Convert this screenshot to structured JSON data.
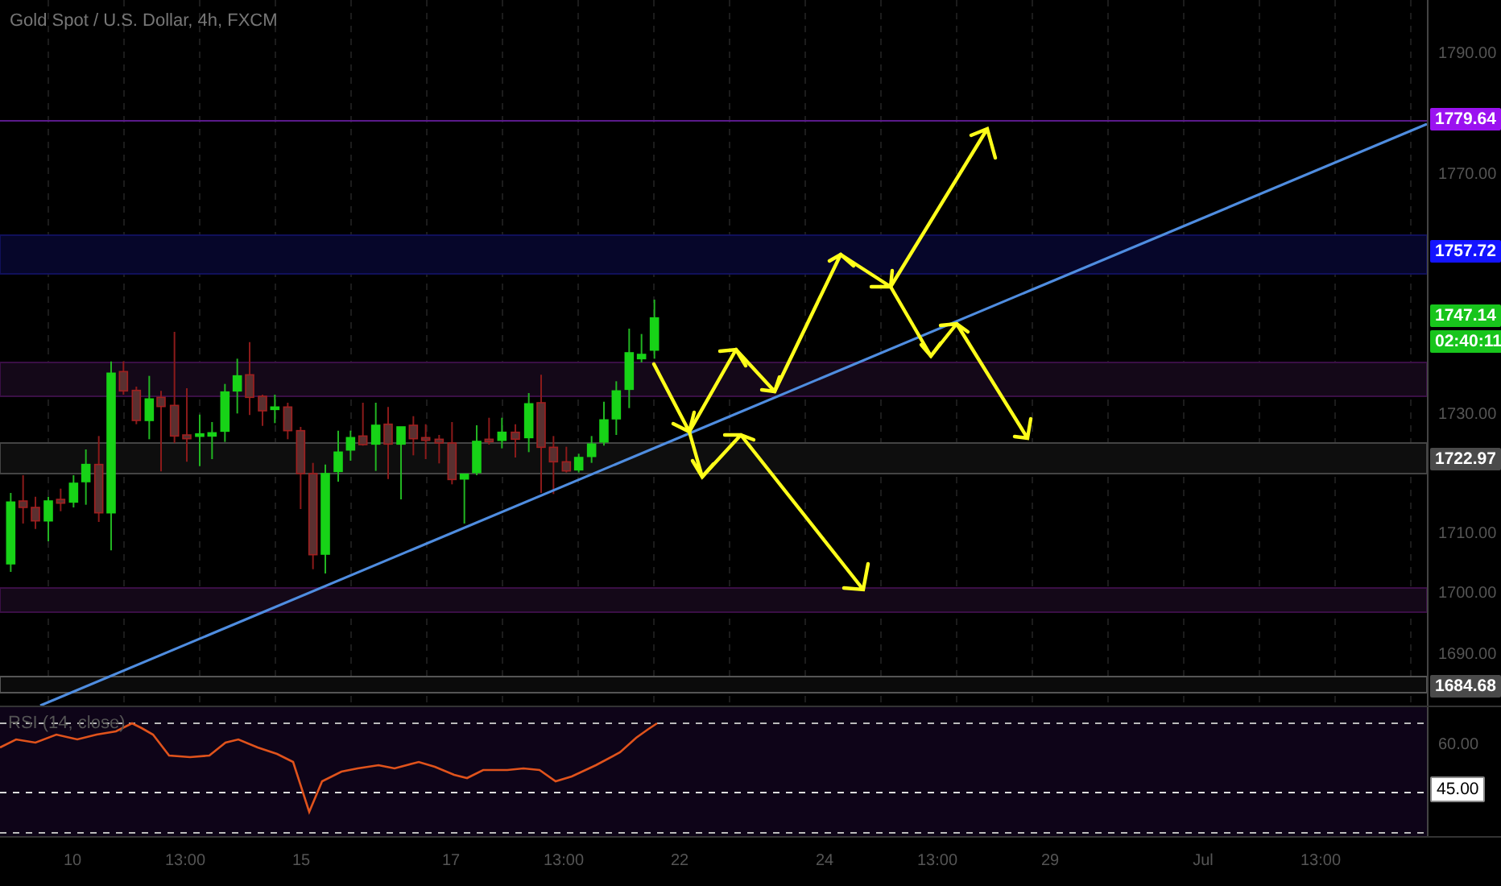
{
  "chart": {
    "title": "Gold Spot / U.S. Dollar, 4h, FXCM"
  },
  "price_axis": {
    "labels": [
      {
        "kind": "tick",
        "text": "1790.00"
      },
      {
        "kind": "badge",
        "text": "1779.64",
        "color": "#9b12f0"
      },
      {
        "kind": "tick",
        "text": "1770.00"
      },
      {
        "kind": "badge",
        "text": "1757.72",
        "color": "#1414ff"
      },
      {
        "kind": "badge",
        "text": "1747.14",
        "color": "#18c51c"
      },
      {
        "kind": "badge",
        "text": "02:40:11",
        "color": "#18c51c"
      },
      {
        "kind": "tick",
        "text": "1730.00"
      },
      {
        "kind": "badge",
        "text": "1722.97",
        "color": "#4a4a4a"
      },
      {
        "kind": "tick",
        "text": "1710.00"
      },
      {
        "kind": "tick",
        "text": "1700.00"
      },
      {
        "kind": "tick",
        "text": "1690.00"
      },
      {
        "kind": "badge",
        "text": "1684.68",
        "color": "#4a4a4a"
      }
    ]
  },
  "rsi": {
    "title": "RSI (14, close)",
    "axis": [
      {
        "kind": "tick",
        "text": "60.00"
      },
      {
        "kind": "badge",
        "text": "45.00",
        "color": "#ffffff"
      }
    ]
  },
  "time_axis": [
    "10",
    "13:00",
    "15",
    "17",
    "13:00",
    "22",
    "24",
    "13:00",
    "29",
    "Jul",
    "13:00"
  ]
}
